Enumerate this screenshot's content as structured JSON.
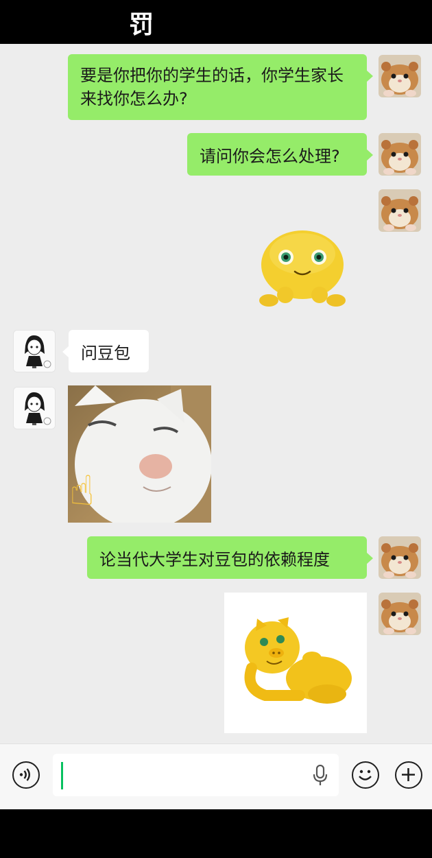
{
  "overlay_caption": "罚",
  "messages": [
    {
      "sender": "self",
      "type": "text",
      "text": "要是你把你的学生的话，你学生家长来找你怎么办?"
    },
    {
      "sender": "self",
      "type": "text",
      "text": "请问你会怎么处理?"
    },
    {
      "sender": "self",
      "type": "sticker",
      "icon": "yellow-blob-sticker"
    },
    {
      "sender": "other",
      "type": "text",
      "text": "问豆包"
    },
    {
      "sender": "other",
      "type": "sticker",
      "icon": "cat-pointing-finger-sticker"
    },
    {
      "sender": "self",
      "type": "text",
      "text": "论当代大学生对豆包的依赖程度"
    },
    {
      "sender": "self",
      "type": "sticker",
      "icon": "yellow-pig-reclining-sticker"
    }
  ],
  "emoji": {
    "pointing_up": "☝"
  },
  "input_bar": {
    "placeholder": "",
    "value": "",
    "voice_icon": "voice-icon",
    "mic_icon": "microphone-icon",
    "emoji_icon": "smiley-icon",
    "plus_icon": "plus-icon"
  },
  "colors": {
    "chat_background": "#ededed",
    "self_bubble": "#95ec69",
    "other_bubble": "#ffffff",
    "cursor": "#07c160"
  }
}
